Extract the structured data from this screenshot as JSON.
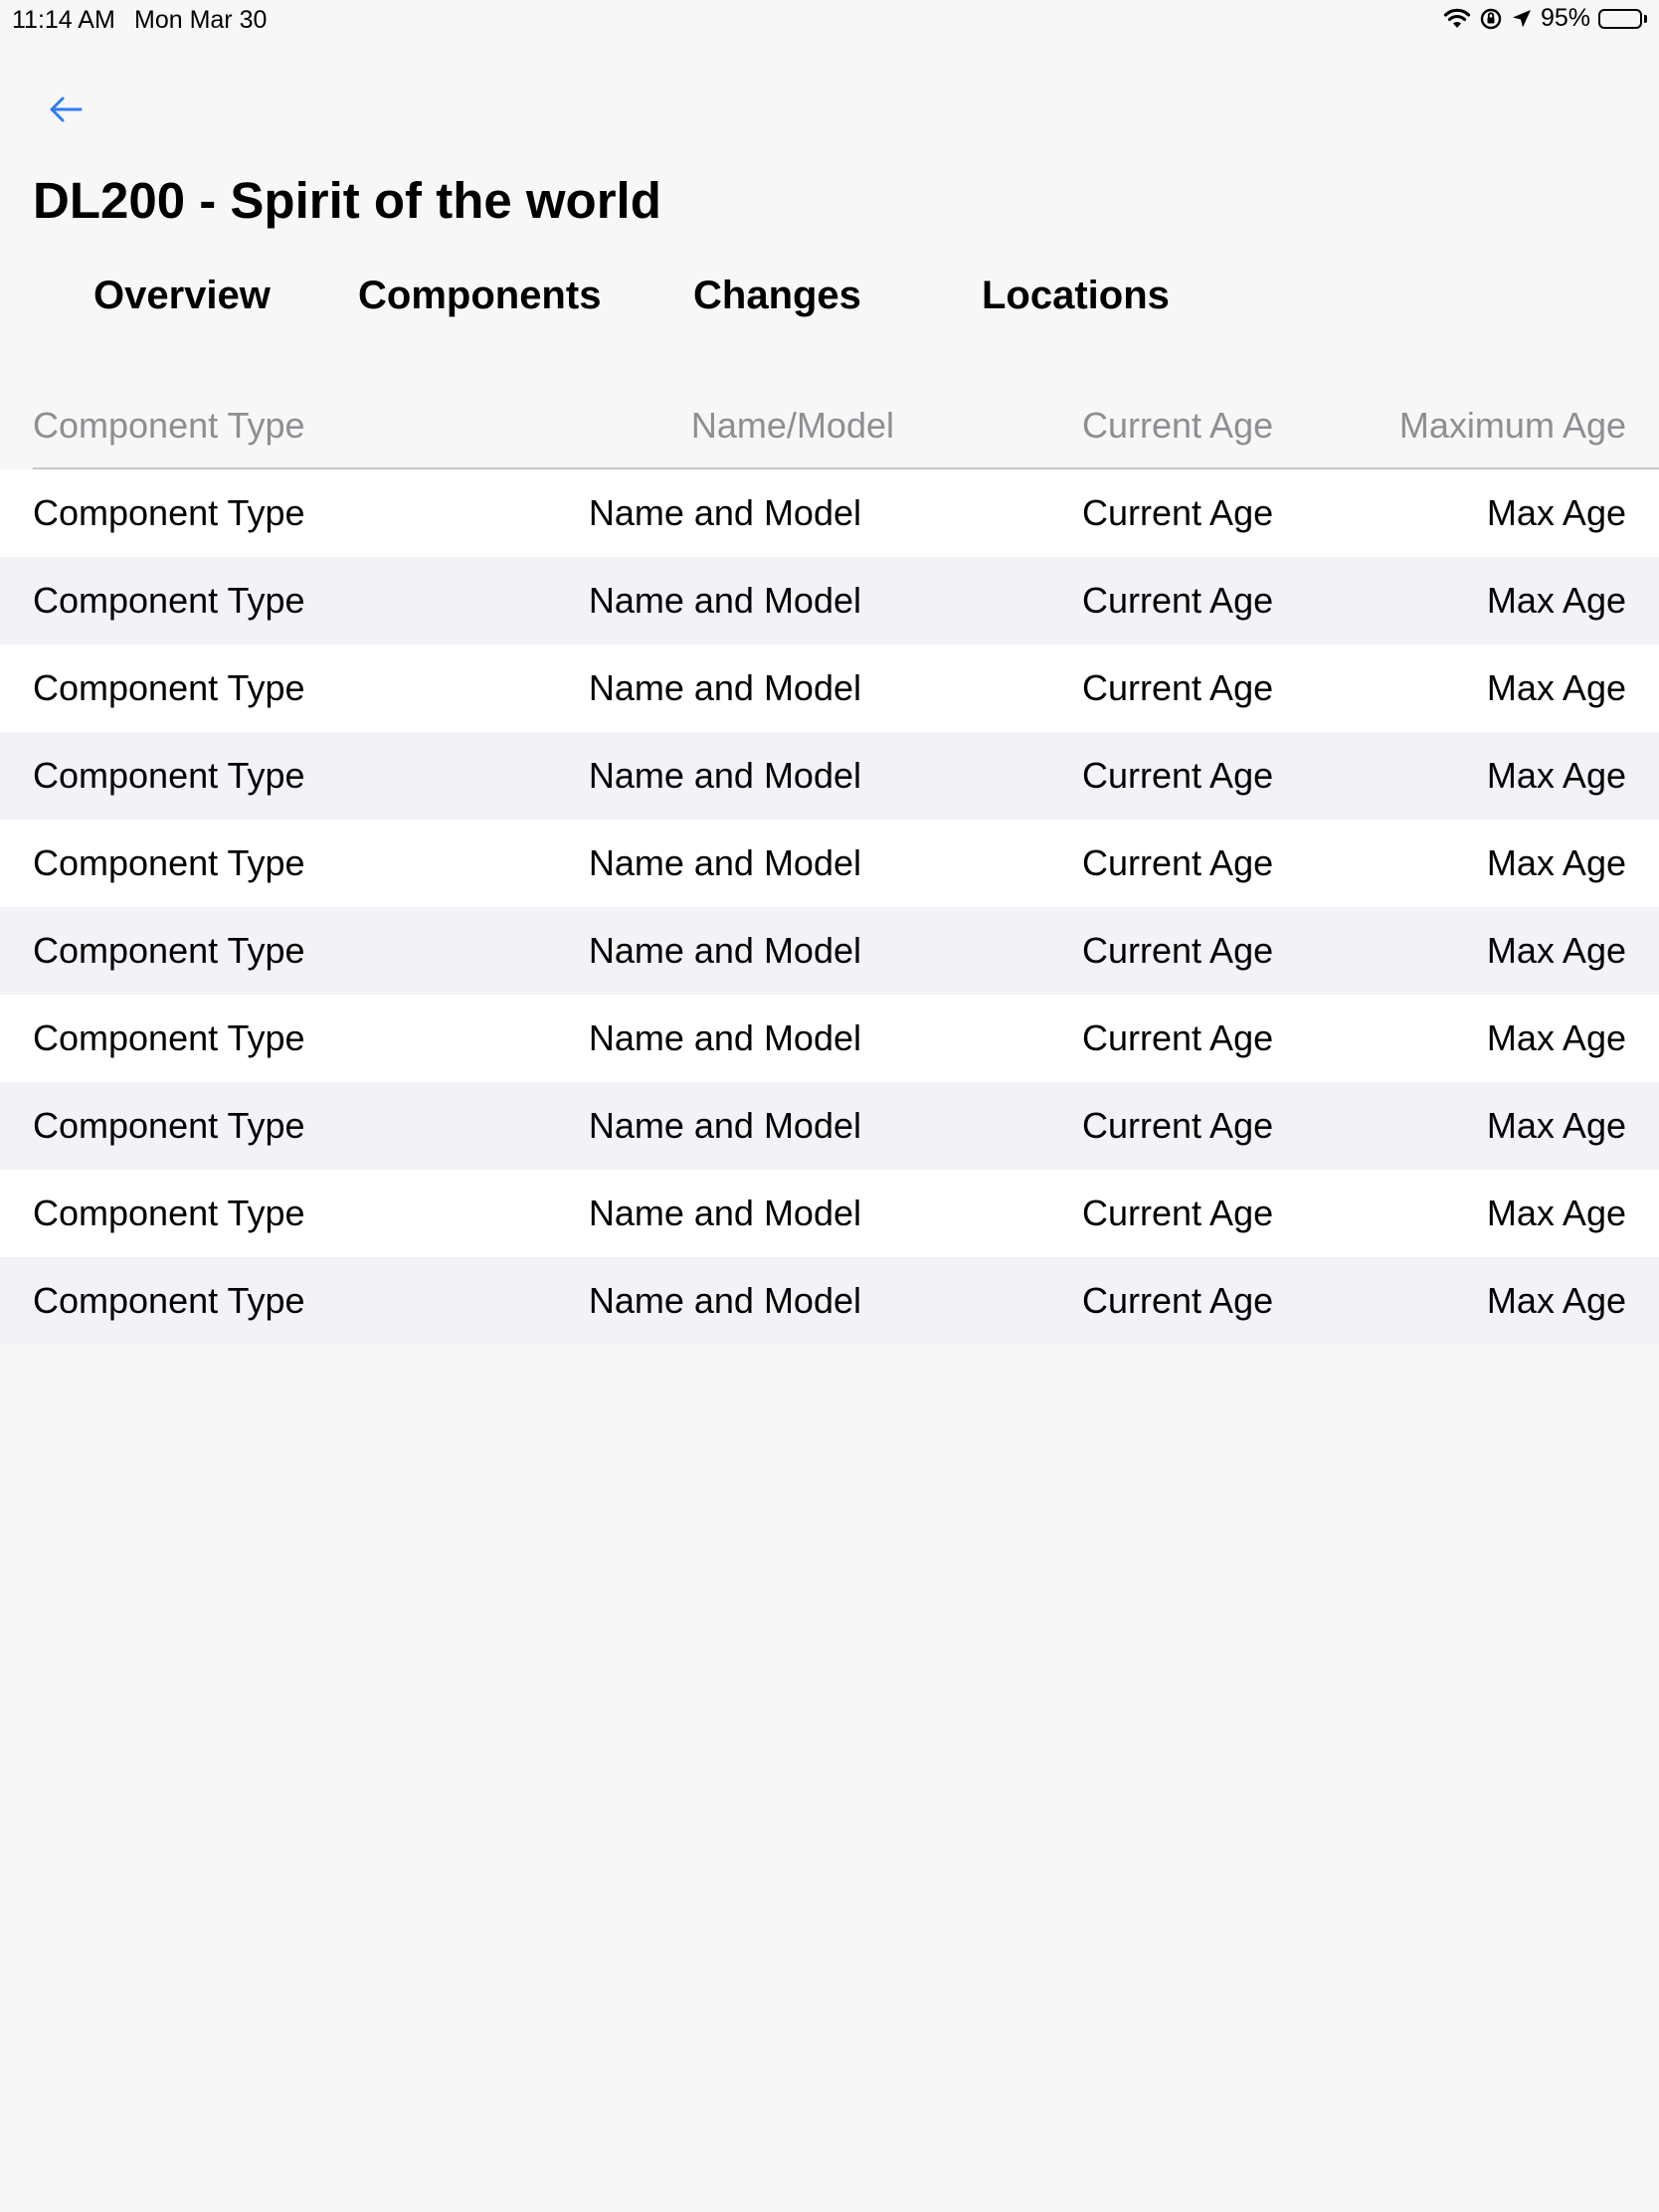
{
  "status_bar": {
    "time": "11:14 AM",
    "date": "Mon Mar 30",
    "battery": "95%",
    "battery_level": 0.95
  },
  "nav": {
    "back_icon": "arrow-left-icon",
    "accent_color": "#2f7cf6"
  },
  "page": {
    "title": "DL200 - Spirit of the world"
  },
  "tabs": [
    {
      "label": "Overview"
    },
    {
      "label": "Components"
    },
    {
      "label": "Changes"
    },
    {
      "label": "Locations"
    }
  ],
  "table": {
    "headers": [
      "Component Type",
      "Name/Model",
      "Current Age",
      "Maximum Age"
    ],
    "rows": [
      [
        "Component Type",
        "Name and Model",
        "Current Age",
        "Max Age"
      ],
      [
        "Component Type",
        "Name and Model",
        "Current Age",
        "Max Age"
      ],
      [
        "Component Type",
        "Name and Model",
        "Current Age",
        "Max Age"
      ],
      [
        "Component Type",
        "Name and Model",
        "Current Age",
        "Max Age"
      ],
      [
        "Component Type",
        "Name and Model",
        "Current Age",
        "Max Age"
      ],
      [
        "Component Type",
        "Name and Model",
        "Current Age",
        "Max Age"
      ],
      [
        "Component Type",
        "Name and Model",
        "Current Age",
        "Max Age"
      ],
      [
        "Component Type",
        "Name and Model",
        "Current Age",
        "Max Age"
      ],
      [
        "Component Type",
        "Name and Model",
        "Current Age",
        "Max Age"
      ],
      [
        "Component Type",
        "Name and Model",
        "Current Age",
        "Max Age"
      ]
    ]
  }
}
